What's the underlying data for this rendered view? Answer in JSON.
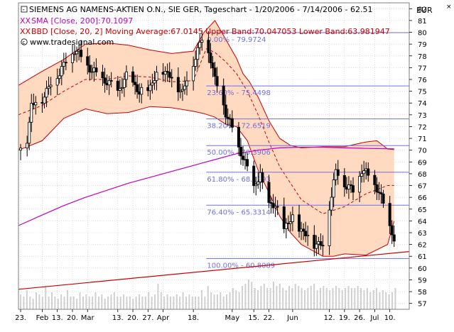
{
  "header": {
    "title": "SIEMENS AG NAMENS-AKTIEN O.N., SIE GER, Tageschart - 1/20/2006 - 7/14/2006 - 62.51",
    "sma_label": "SMA [Close, 200]:70.1097",
    "bbd_label": "BBD [Close, 20, 2] Moving Average:67.0145 Upper Band:70.047053 Lower Band:63.981947",
    "watermark": "www.tradesignal.com",
    "currency": "EUR",
    "toggle_icon": "XX",
    "minus_icon": "-",
    "close_icon": "×",
    "colors": {
      "sma": "#c000c0",
      "bbd": "#cc0000",
      "band_fill": "#ffd9c0",
      "fib": "#7070e0",
      "grid": "#c8c8c8",
      "candle": "#000000",
      "volume": "#d0d0d0",
      "trend": "#cc0000"
    }
  },
  "chart_data": {
    "type": "candlestick",
    "title": "SIEMENS AG NAMENS-AKTIEN O.N., SIE GER, Tageschart - 1/20/2006 - 7/14/2006 - 62.51",
    "y_unit": "EUR",
    "ylim": [
      56.5,
      82.5
    ],
    "y_ticks": [
      57,
      58,
      59,
      60,
      61,
      62,
      63,
      64,
      65,
      66,
      67,
      68,
      69,
      70,
      71,
      72,
      73,
      74,
      75,
      76,
      77,
      78,
      79,
      80,
      81,
      82
    ],
    "x_tick_labels": [
      "23.",
      "Feb",
      "13.",
      "20.",
      "Mar",
      "13.",
      "20.",
      "27.",
      "Apr",
      "18.",
      "May",
      "15.",
      "22.",
      "Jun",
      "12.",
      "19.",
      "26.",
      "Jul",
      "10."
    ],
    "x_tick_days": [
      0,
      10,
      17,
      24,
      31,
      45,
      52,
      59,
      66,
      80,
      98,
      108,
      115,
      126,
      143,
      150,
      157,
      164,
      171
    ],
    "x_range_days": [
      -1,
      180
    ],
    "last_close": 62.51,
    "grid": true,
    "fibonacci": [
      {
        "label": "0.00% - 79.9724",
        "value": 79.9724
      },
      {
        "label": "23.60% - 75.4498",
        "value": 75.4498
      },
      {
        "label": "38.20% - 72.6519",
        "value": 72.6519
      },
      {
        "label": "50.00% - 70.3906",
        "value": 70.3906
      },
      {
        "label": "61.80% - 68.1293",
        "value": 68.1293
      },
      {
        "label": "76.40% - 65.3314",
        "value": 65.3314
      },
      {
        "label": "100.00% - 60.8089",
        "value": 60.8089
      }
    ],
    "close_series": {
      "days": [
        0,
        3,
        5,
        10,
        14,
        20,
        25,
        30,
        35,
        40,
        45,
        50,
        55,
        60,
        65,
        70,
        75,
        80,
        85,
        88,
        90,
        93,
        95,
        98,
        100,
        103,
        106,
        108,
        111,
        113,
        118,
        122,
        126,
        130,
        136,
        140,
        142,
        144,
        146,
        150,
        154,
        158,
        162,
        166,
        170,
        173
      ],
      "values": [
        70.0,
        71.0,
        73.8,
        74.4,
        75.6,
        77.2,
        78.6,
        77.4,
        76.4,
        75.8,
        75.0,
        76.5,
        74.8,
        75.4,
        77.0,
        76.1,
        74.9,
        77.5,
        79.9,
        77.8,
        75.9,
        74.6,
        73.2,
        71.8,
        70.6,
        69.4,
        67.8,
        66.9,
        67.9,
        65.8,
        65.2,
        63.5,
        64.2,
        63.2,
        62.1,
        61.9,
        64.5,
        66.2,
        68.2,
        67.2,
        66.5,
        68.4,
        67.6,
        66.5,
        64.0,
        62.5
      ]
    },
    "sma_200": {
      "days": [
        -1,
        10,
        20,
        30,
        40,
        50,
        60,
        70,
        80,
        85,
        90,
        95,
        100,
        110,
        120,
        130,
        140,
        150,
        160,
        170,
        173
      ],
      "values": [
        63.6,
        64.5,
        65.3,
        66.0,
        66.6,
        67.2,
        67.7,
        68.2,
        68.7,
        68.95,
        69.2,
        69.45,
        69.7,
        70.0,
        70.2,
        70.25,
        70.25,
        70.2,
        70.15,
        70.12,
        70.11
      ]
    },
    "bb_middle": {
      "days": [
        -1,
        10,
        20,
        30,
        40,
        50,
        60,
        70,
        80,
        86,
        90,
        95,
        100,
        105,
        110,
        115,
        120,
        130,
        140,
        150,
        160,
        170,
        173
      ],
      "values": [
        73.0,
        73.8,
        75.0,
        76.0,
        76.0,
        76.3,
        76.2,
        75.8,
        75.9,
        78.6,
        78.3,
        77.5,
        76.5,
        75.0,
        73.0,
        70.7,
        68.6,
        65.8,
        64.6,
        65.2,
        66.3,
        67.0,
        67.01
      ]
    },
    "bb_upper": {
      "days": [
        -1,
        10,
        20,
        30,
        40,
        50,
        60,
        70,
        80,
        85,
        90,
        95,
        100,
        103,
        106,
        110,
        115,
        120,
        125,
        130,
        140,
        150,
        160,
        165,
        170,
        173
      ],
      "values": [
        75.5,
        76.7,
        77.7,
        79.0,
        79.1,
        78.9,
        78.5,
        78.2,
        78.4,
        80.0,
        81.0,
        79.4,
        77.8,
        76.5,
        75.8,
        74.5,
        72.5,
        71.0,
        70.4,
        70.2,
        70.3,
        70.3,
        70.7,
        70.8,
        70.1,
        70.05
      ]
    },
    "bb_lower": {
      "days": [
        -1,
        10,
        20,
        30,
        40,
        50,
        60,
        70,
        80,
        85,
        90,
        95,
        100,
        105,
        110,
        115,
        120,
        125,
        130,
        136,
        140,
        145,
        150,
        160,
        170,
        173
      ],
      "values": [
        70.0,
        70.8,
        72.7,
        73.5,
        73.1,
        73.2,
        73.7,
        73.6,
        73.3,
        73.1,
        72.8,
        72.2,
        72.0,
        70.8,
        68.3,
        66.4,
        64.4,
        63.0,
        62.0,
        61.4,
        61.0,
        61.0,
        61.2,
        61.1,
        62.0,
        63.98
      ]
    },
    "trendline": {
      "days": [
        -1,
        180
      ],
      "values": [
        58.2,
        61.4
      ]
    },
    "volume_relative": [
      0.35,
      0.3,
      0.45,
      0.3,
      0.25,
      0.4,
      0.35,
      0.3,
      0.55,
      0.3,
      0.4,
      0.3,
      0.25,
      0.35,
      0.3,
      0.45,
      0.3,
      0.3,
      0.25,
      0.4,
      0.3,
      0.35,
      0.3,
      0.3,
      0.4,
      0.3,
      0.35,
      0.25,
      0.3,
      0.35,
      0.4,
      0.3,
      0.3,
      0.35,
      0.3,
      0.3,
      0.25,
      0.3,
      0.35,
      0.3,
      0.3,
      0.4,
      0.3,
      0.35,
      0.6,
      0.4,
      0.3,
      0.35,
      0.3,
      0.3,
      0.35,
      0.3,
      0.4,
      0.3,
      0.35,
      0.3,
      0.3,
      0.3,
      0.45,
      0.3,
      0.55,
      0.4,
      0.35,
      0.35,
      0.4,
      0.3,
      0.35,
      0.4,
      0.5,
      0.45,
      0.4,
      0.55,
      0.6,
      0.7,
      0.65,
      0.5,
      0.45,
      0.55,
      0.6,
      0.5,
      0.5,
      0.65,
      0.55,
      0.6,
      0.5,
      0.45,
      0.55,
      0.5,
      0.6,
      0.55,
      0.5,
      0.45,
      0.5,
      0.55,
      0.6,
      0.45,
      0.5,
      0.55,
      0.5,
      0.45,
      0.5,
      0.55,
      0.5,
      0.45,
      0.5,
      0.55,
      0.5,
      0.5,
      0.55,
      0.5,
      0.45,
      0.5,
      0.4,
      0.45,
      0.5,
      0.4,
      0.45,
      0.4,
      0.35,
      0.4,
      0.5
    ]
  }
}
